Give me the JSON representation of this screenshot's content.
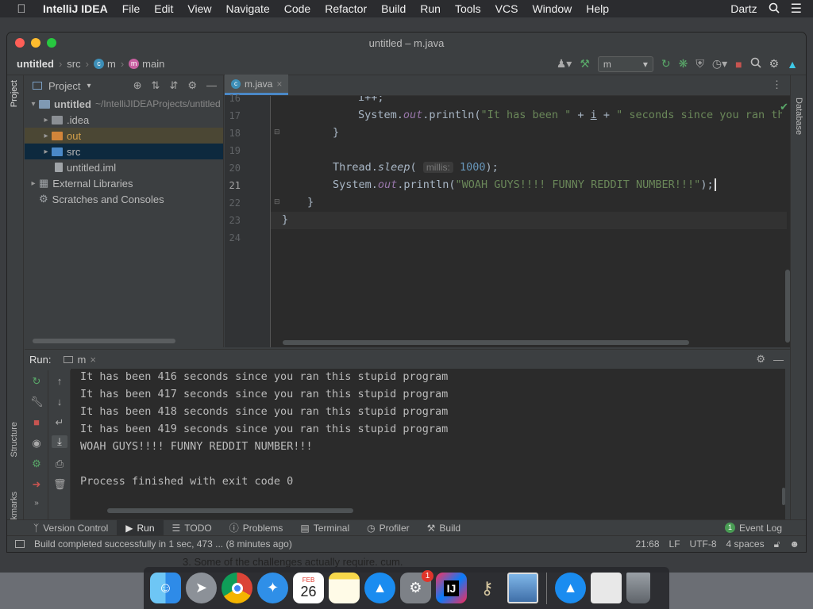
{
  "menubar": {
    "items": [
      "IntelliJ IDEA",
      "File",
      "Edit",
      "View",
      "Navigate",
      "Code",
      "Refactor",
      "Build",
      "Run",
      "Tools",
      "VCS",
      "Window",
      "Help"
    ],
    "user": "Dartz"
  },
  "window": {
    "title": "untitled – m.java",
    "breadcrumbs": [
      "untitled",
      "src",
      "m",
      "main"
    ],
    "run_config": "m"
  },
  "project_panel": {
    "title": "Project",
    "tree": [
      {
        "label": "untitled",
        "path": "~/IntelliJIDEAProjects/untitled",
        "bold": true
      },
      {
        "label": ".idea"
      },
      {
        "label": "out"
      },
      {
        "label": "src"
      },
      {
        "label": "untitled.iml"
      },
      {
        "label": "External Libraries"
      },
      {
        "label": "Scratches and Consoles"
      }
    ]
  },
  "editor": {
    "tab_label": "m.java",
    "line_numbers": [
      "16",
      "17",
      "18",
      "19",
      "20",
      "21",
      "22",
      "23",
      "24"
    ],
    "code": {
      "l16": "i++;",
      "l17_a": "System.",
      "l17_b": "out",
      "l17_c": ".println(",
      "l17_d": "\"It has been \"",
      "l17_e": " + ",
      "l17_f": "i",
      "l17_g": " + ",
      "l17_h": "\" seconds since you ran this",
      "l18": "}",
      "l20_a": "Thread.",
      "l20_b": "sleep",
      "l20_c": "( ",
      "l20_hint": "millis:",
      "l20_num": "1000",
      "l20_d": ");",
      "l21_a": "System.",
      "l21_b": "out",
      "l21_c": ".println(",
      "l21_d": "\"WOAH GUYS!!!! FUNNY REDDIT NUMBER!!!\"",
      "l21_e": ");",
      "l22": "}",
      "l23": "}"
    }
  },
  "right_stripe": {
    "label": "Database"
  },
  "left_stripe": {
    "project": "Project",
    "structure": "Structure",
    "bookmarks": "Bookmarks"
  },
  "run_panel": {
    "label": "Run:",
    "tab": "m",
    "lines": [
      "It has been 416 seconds since you ran this stupid program",
      "It has been 417 seconds since you ran this stupid program",
      "It has been 418 seconds since you ran this stupid program",
      "It has been 419 seconds since you ran this stupid program",
      "WOAH GUYS!!!! FUNNY REDDIT NUMBER!!!",
      "",
      "Process finished with exit code 0"
    ]
  },
  "tool_windows": [
    "Version Control",
    "Run",
    "TODO",
    "Problems",
    "Terminal",
    "Profiler",
    "Build"
  ],
  "event_log": {
    "label": "Event Log",
    "count": "1"
  },
  "status": {
    "message": "Build completed successfully in 1 sec, 473 ... (8 minutes ago)",
    "position": "21:68",
    "line_sep": "LF",
    "encoding": "UTF-8",
    "indent": "4 spaces"
  },
  "background": {
    "text": "3. Some of the challenges actually require. cum."
  },
  "dock": {
    "calendar_month": "FEB",
    "calendar_day": "26",
    "prefs_badge": "1"
  },
  "colors": {
    "accent": "#4a88c7",
    "editor_bg": "#2b2b2b",
    "panel_bg": "#3c3f41"
  }
}
